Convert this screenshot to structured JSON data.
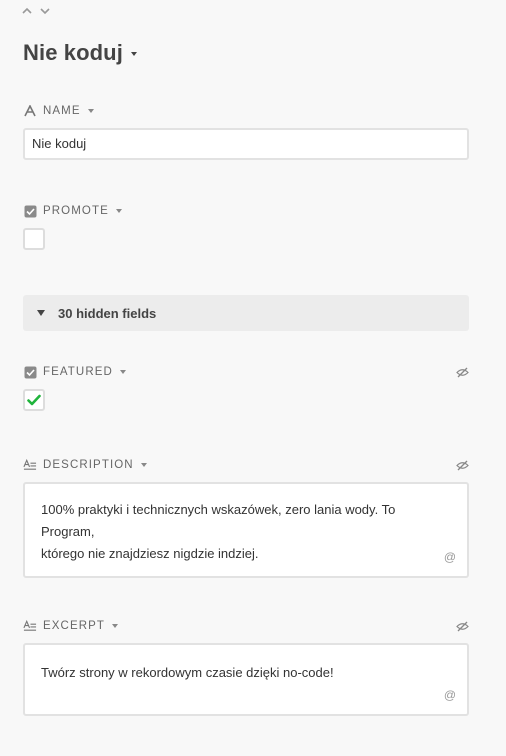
{
  "nav": {
    "prev_icon": "chevron-up-icon",
    "next_icon": "chevron-down-icon"
  },
  "record": {
    "title": "Nie koduj"
  },
  "fields": {
    "name": {
      "label": "NAME",
      "icon": "text-type-icon",
      "value": "Nie koduj"
    },
    "promote": {
      "label": "PROMOTE",
      "icon": "checkbox-icon",
      "checked": false
    },
    "hidden": {
      "label": "30 hidden fields"
    },
    "featured": {
      "label": "FEATURED",
      "icon": "checkbox-icon",
      "checked": true,
      "check_color": "#20b43c"
    },
    "description": {
      "label": "DESCRIPTION",
      "icon": "long-text-icon",
      "line1": "100% praktyki i technicznych wskazówek, zero lania wody. To Program,",
      "line2": "którego nie znajdziesz nigdzie indziej.",
      "mention": "@"
    },
    "excerpt": {
      "label": "EXCERPT",
      "icon": "long-text-icon",
      "value": "Twórz strony w rekordowym czasie dzięki no-code!",
      "mention": "@"
    }
  }
}
